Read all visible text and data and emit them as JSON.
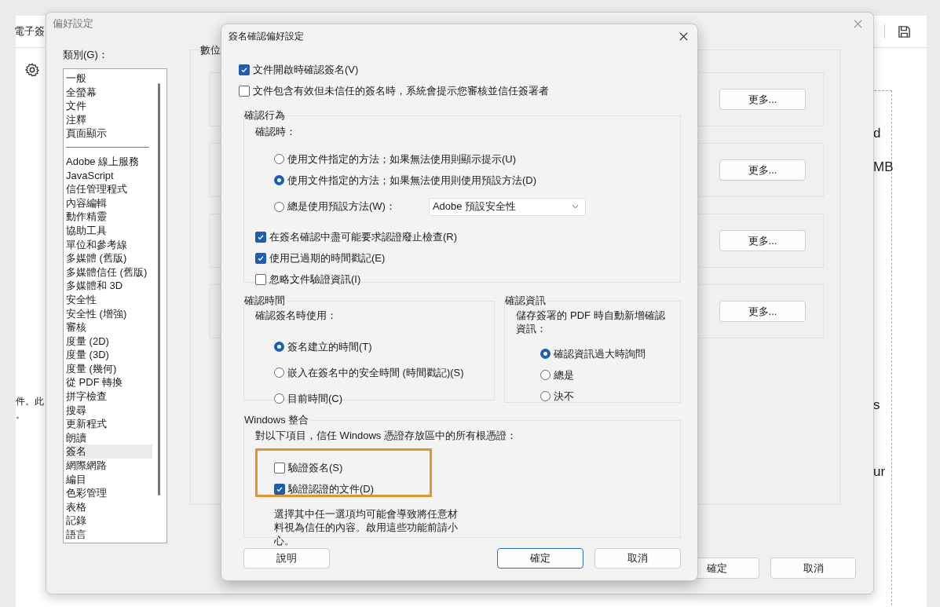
{
  "background_app": {
    "title": "電子簽",
    "fragments_left": [
      "件。此",
      "。"
    ],
    "fragments_right": [
      "d",
      "MB",
      "s",
      "ur"
    ]
  },
  "preferences": {
    "title": "偏好設定",
    "category_label": "類別(G)：",
    "category_groups": [
      [
        {
          "label": "一般",
          "selected": false
        },
        {
          "label": "全螢幕",
          "selected": false
        },
        {
          "label": "文件",
          "selected": false
        },
        {
          "label": "注釋",
          "selected": false
        },
        {
          "label": "頁面顯示",
          "selected": false
        }
      ],
      [
        {
          "label": "Adobe 線上服務",
          "selected": false
        },
        {
          "label": "JavaScript",
          "selected": false
        },
        {
          "label": "信任管理程式",
          "selected": false
        },
        {
          "label": "內容編輯",
          "selected": false
        },
        {
          "label": "動作精靈",
          "selected": false
        },
        {
          "label": "協助工具",
          "selected": false
        },
        {
          "label": "單位和參考線",
          "selected": false
        },
        {
          "label": "多媒體 (舊版)",
          "selected": false
        },
        {
          "label": "多媒體信任 (舊版)",
          "selected": false
        },
        {
          "label": "多媒體和 3D",
          "selected": false
        },
        {
          "label": "安全性",
          "selected": false
        },
        {
          "label": "安全性 (增強)",
          "selected": false
        },
        {
          "label": "審核",
          "selected": false
        },
        {
          "label": "度量 (2D)",
          "selected": false
        },
        {
          "label": "度量 (3D)",
          "selected": false
        },
        {
          "label": "度量 (幾何)",
          "selected": false
        },
        {
          "label": "從 PDF 轉換",
          "selected": false
        },
        {
          "label": "拼字檢查",
          "selected": false
        },
        {
          "label": "搜尋",
          "selected": false
        },
        {
          "label": "更新程式",
          "selected": false
        },
        {
          "label": "朗讀",
          "selected": false
        },
        {
          "label": "簽名",
          "selected": true
        },
        {
          "label": "網際網路",
          "selected": false
        },
        {
          "label": "編目",
          "selected": false
        },
        {
          "label": "色彩管理",
          "selected": false
        },
        {
          "label": "表格",
          "selected": false
        },
        {
          "label": "記錄",
          "selected": false
        },
        {
          "label": "語言",
          "selected": false
        }
      ]
    ],
    "panel_title": "數位",
    "more_buttons": [
      "更多...",
      "更多...",
      "更多...",
      "更多..."
    ],
    "buttons": [
      "確定",
      "取消"
    ]
  },
  "dialog": {
    "title": "簽名確認偏好設定",
    "top_options": [
      {
        "label": "文件開啟時確認簽名(V)",
        "checked": true
      },
      {
        "label": "文件包含有效但未信任的簽名時，系統會提示您審核並信任簽署者",
        "checked": false
      }
    ],
    "verification_behavior": {
      "legend": "確認行為",
      "prompt": "確認時：",
      "radios": [
        {
          "label": "使用文件指定的方法；如果無法使用則顯示提示(U)",
          "selected": false
        },
        {
          "label": "使用文件指定的方法；如果無法使用則使用預設方法(D)",
          "selected": true
        },
        {
          "label": "總是使用預設方法(W)：",
          "selected": false,
          "dropdown": "Adobe 預設安全性"
        }
      ],
      "checks": [
        {
          "label": "在簽名確認中盡可能要求認證廢止檢查(R)",
          "checked": true
        },
        {
          "label": "使用已過期的時間戳記(E)",
          "checked": true
        },
        {
          "label": "忽略文件驗證資訊(I)",
          "checked": false
        }
      ]
    },
    "verification_time": {
      "legend": "確認時間",
      "prompt": "確認簽名時使用：",
      "radios": [
        {
          "label": "簽名建立的時間(T)",
          "selected": true
        },
        {
          "label": "嵌入在簽名中的安全時間 (時間戳記)(S)",
          "selected": false
        },
        {
          "label": "目前時間(C)",
          "selected": false
        }
      ]
    },
    "verification_info": {
      "legend": "確認資訊",
      "prompt": "儲存簽署的 PDF 時自動新增確認資訊：",
      "radios": [
        {
          "label": "確認資訊過大時詢問",
          "selected": true
        },
        {
          "label": "總是",
          "selected": false
        },
        {
          "label": "決不",
          "selected": false
        }
      ]
    },
    "windows_integration": {
      "legend": "Windows 整合",
      "prompt": "對以下項目，信任 Windows 憑證存放區中的所有根憑證：",
      "highlighted": true,
      "checks": [
        {
          "label": "驗證簽名(S)",
          "checked": false
        },
        {
          "label": "驗證認證的文件(D)",
          "checked": true
        }
      ],
      "note": "選擇其中任一選項均可能會導致將任意材料視為信任的內容。啟用這些功能前請小心。"
    },
    "buttons": [
      {
        "label": "說明",
        "default": false
      },
      {
        "label": "確定",
        "default": true
      },
      {
        "label": "取消",
        "default": false
      }
    ]
  }
}
